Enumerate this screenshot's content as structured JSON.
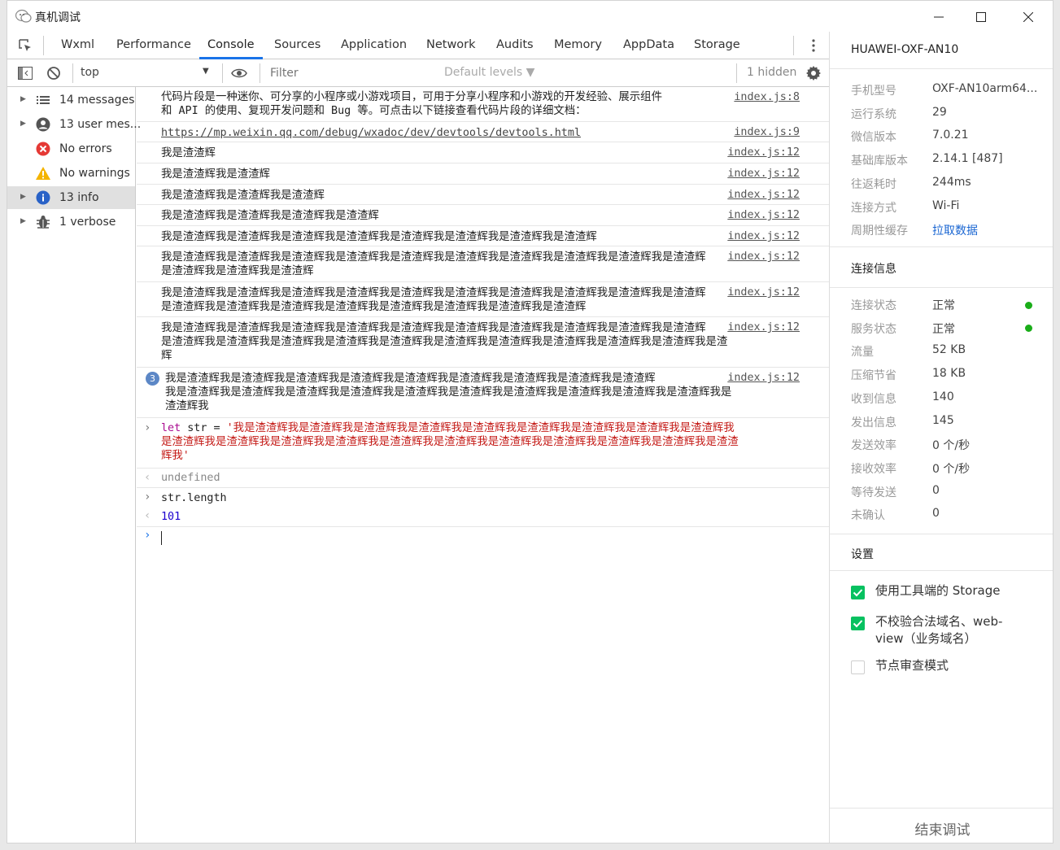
{
  "window": {
    "title": "真机调试",
    "controls": [
      "minimize",
      "maximize",
      "close"
    ]
  },
  "tabs": [
    "Wxml",
    "Performance",
    "Console",
    "Sources",
    "Application",
    "Network",
    "Audits",
    "Memory",
    "AppData",
    "Storage"
  ],
  "active_tab": "Console",
  "toolbar": {
    "context": "top",
    "filter_placeholder": "Filter",
    "levels": "Default levels ▼",
    "hidden": "1 hidden"
  },
  "sidebar": {
    "items": [
      {
        "label": "14 messages",
        "icon": "list-icon"
      },
      {
        "label": "13 user mes...",
        "icon": "user-icon"
      },
      {
        "label": "No errors",
        "icon": "error-icon"
      },
      {
        "label": "No warnings",
        "icon": "warning-icon"
      },
      {
        "label": "13 info",
        "icon": "info-icon",
        "selected": true
      },
      {
        "label": "1 verbose",
        "icon": "bug-icon"
      }
    ]
  },
  "console": {
    "intro_line1": "代码片段是一种迷你、可分享的小程序或小游戏项目，可用于分享小程序和小游戏的开发经验、展示组件",
    "intro_line2": "和 API 的使用、复现开发问题和 Bug 等。可点击以下链接查看代码片段的详细文档：",
    "intro_src": "index.js:8",
    "link": "https://mp.weixin.qq.com/debug/wxadoc/dev/devtools/devtools.html",
    "link_src": "index.js:9",
    "logs": [
      {
        "lines": [
          "我是渣渣辉"
        ],
        "src": "index.js:12"
      },
      {
        "lines": [
          "我是渣渣辉我是渣渣辉"
        ],
        "src": "index.js:12"
      },
      {
        "lines": [
          "我是渣渣辉我是渣渣辉我是渣渣辉"
        ],
        "src": "index.js:12"
      },
      {
        "lines": [
          "我是渣渣辉我是渣渣辉我是渣渣辉我是渣渣辉"
        ],
        "src": "index.js:12"
      },
      {
        "lines": [
          "我是渣渣辉我是渣渣辉我是渣渣辉我是渣渣辉我是渣渣辉我是渣渣辉我是渣渣辉我是渣渣辉"
        ],
        "src": "index.js:12"
      },
      {
        "lines": [
          "我是渣渣辉我是渣渣辉我是渣渣辉我是渣渣辉我是渣渣辉我是渣渣辉我是渣渣辉我是渣渣辉我是渣渣辉我是渣渣辉",
          "是渣渣辉我是渣渣辉我是渣渣辉"
        ],
        "src": "index.js:12"
      },
      {
        "lines": [
          "我是渣渣辉我是渣渣辉我是渣渣辉我是渣渣辉我是渣渣辉我是渣渣辉我是渣渣辉我是渣渣辉我是渣渣辉我是渣渣辉",
          "是渣渣辉我是渣渣辉我是渣渣辉我是渣渣辉我是渣渣辉我是渣渣辉我是渣渣辉我是渣渣辉"
        ],
        "src": "index.js:12"
      },
      {
        "lines": [
          "我是渣渣辉我是渣渣辉我是渣渣辉我是渣渣辉我是渣渣辉我是渣渣辉我是渣渣辉我是渣渣辉我是渣渣辉我是渣渣辉",
          "是渣渣辉我是渣渣辉我是渣渣辉我是渣渣辉我是渣渣辉我是渣渣辉我是渣渣辉我是渣渣辉我是渣渣辉我是渣渣辉我是渣",
          "辉"
        ],
        "src": "index.js:12"
      }
    ],
    "grouped": {
      "count": "3",
      "lines": [
        "我是渣渣辉我是渣渣辉我是渣渣辉我是渣渣辉我是渣渣辉我是渣渣辉我是渣渣辉我是渣渣辉我是渣渣辉",
        "我是渣渣辉我是渣渣辉我是渣渣辉我是渣渣辉我是渣渣辉我是渣渣辉我是渣渣辉我是渣渣辉我是渣渣辉我是渣渣辉我是",
        "渣渣辉我"
      ],
      "src": "index.js:12"
    },
    "input1": {
      "keyword": "let",
      "name": " str = ",
      "lines": [
        "'我是渣渣辉我是渣渣辉我是渣渣辉我是渣渣辉我是渣渣辉我是渣渣辉我是渣渣辉我是渣渣辉我是渣渣辉我",
        "是渣渣辉我是渣渣辉我是渣渣辉我是渣渣辉我是渣渣辉我是渣渣辉我是渣渣辉我是渣渣辉我是渣渣辉我是渣渣辉我是渣渣",
        "辉我'"
      ]
    },
    "result1": "undefined",
    "input2": "str.length",
    "result2": "101"
  },
  "device": {
    "name": "HUAWEI-OXF-AN10",
    "info": [
      {
        "k": "手机型号",
        "v": "OXF-AN10arm64..."
      },
      {
        "k": "运行系统",
        "v": "29"
      },
      {
        "k": "微信版本",
        "v": "7.0.21"
      },
      {
        "k": "基础库版本",
        "v": "2.14.1 [487]"
      },
      {
        "k": "往返耗时",
        "v": "244ms"
      },
      {
        "k": "连接方式",
        "v": "Wi-Fi"
      },
      {
        "k": "周期性缓存",
        "v": "拉取数据"
      }
    ],
    "conn_title": "连接信息",
    "conn": [
      {
        "k": "连接状态",
        "v": "正常"
      },
      {
        "k": "服务状态",
        "v": "正常"
      },
      {
        "k": "流量",
        "v": "52 KB"
      },
      {
        "k": "压缩节省",
        "v": "18 KB"
      },
      {
        "k": "收到信息",
        "v": "140"
      },
      {
        "k": "发出信息",
        "v": "145"
      },
      {
        "k": "发送效率",
        "v": "0 个/秒"
      },
      {
        "k": "接收效率",
        "v": "0 个/秒"
      },
      {
        "k": "等待发送",
        "v": "0"
      },
      {
        "k": "未确认",
        "v": "0"
      }
    ],
    "settings_title": "设置",
    "settings": [
      {
        "label": "使用工具端的 Storage",
        "checked": true
      },
      {
        "label": "不校验合法域名、web-view（业务域名）",
        "checked": true
      },
      {
        "label": "节点审查模式",
        "checked": false
      }
    ],
    "end_button": "结束调试"
  },
  "colors": {
    "accent": "#1a73e8",
    "link": "#1a66d2",
    "ok": "#1aad19",
    "check": "#07c160",
    "string": "#c41a16",
    "keyword": "#aa0d91",
    "number": "#1c00cf"
  }
}
